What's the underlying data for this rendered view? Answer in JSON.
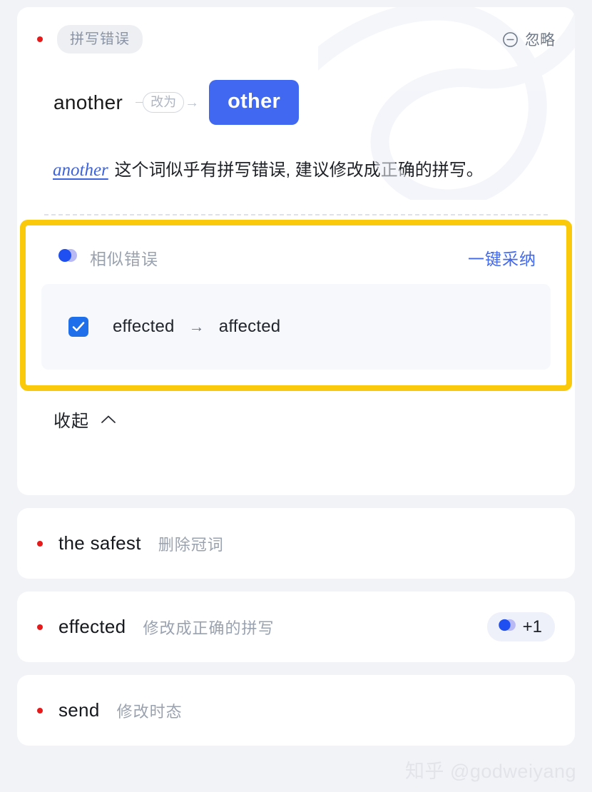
{
  "theme": {
    "page_bg": "#F2F3F7",
    "card_bg": "#FFFFFF",
    "accent_blue": "#4168F0",
    "highlight_yellow": "#FAC90B",
    "error_dot_red": "#E61A1A",
    "muted_text": "#9AA2AF"
  },
  "main_card": {
    "error_type_tag": "拼写错误",
    "ignore_button": {
      "label": "忽略",
      "icon": "minus-circle-icon"
    },
    "correction": {
      "original_word": "another",
      "change_to_label": "改为",
      "suggested_word": "other"
    },
    "explanation": {
      "reference_word": "another",
      "text": "这个词似乎有拼写错误, 建议修改成正确的拼写。"
    },
    "similar_errors": {
      "icon": "overlapping-circles-icon",
      "label": "相似错误",
      "adopt_all_label": "一键采纳",
      "items": [
        {
          "checked": true,
          "from": "effected",
          "arrow": "→",
          "to": "affected"
        }
      ]
    },
    "collapse_button": {
      "label": "收起",
      "icon": "chevron-up-icon"
    }
  },
  "other_cards": [
    {
      "word": "the safest",
      "description": "删除冠词",
      "badge": null
    },
    {
      "word": "effected",
      "description": "修改成正确的拼写",
      "badge": {
        "icon": "overlapping-circles-icon",
        "count": "+1"
      }
    },
    {
      "word": "send",
      "description": "修改时态",
      "badge": null
    }
  ],
  "watermark": "知乎 @godweiyang"
}
